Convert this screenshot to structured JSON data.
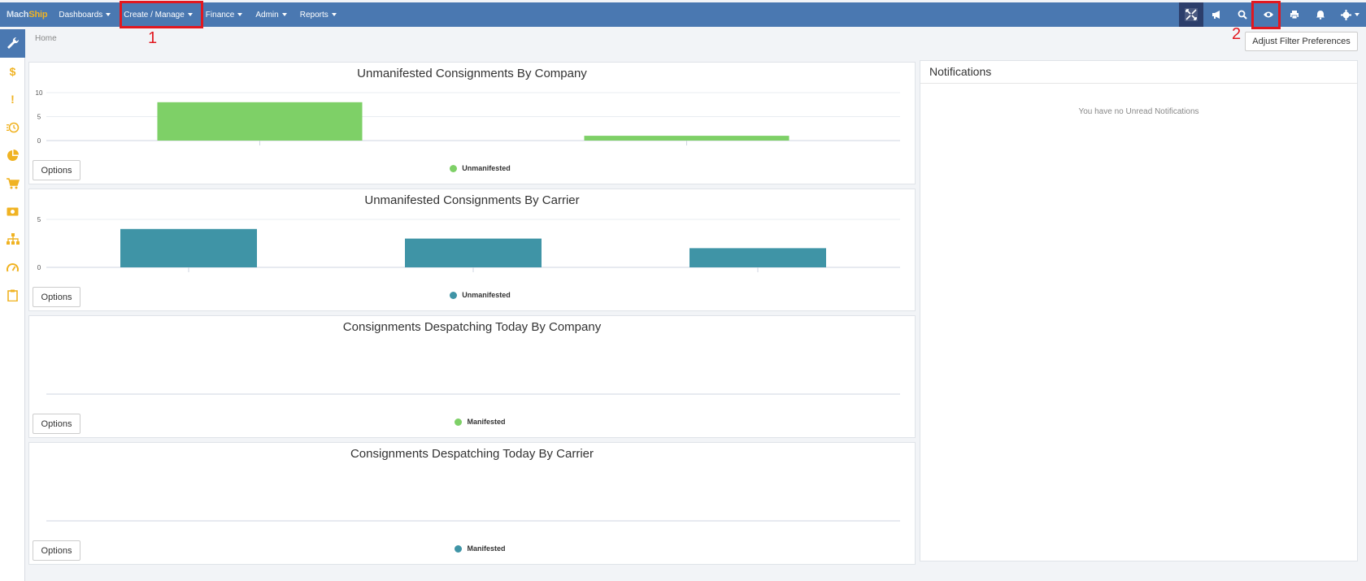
{
  "nav": {
    "logo_prefix": "Mach",
    "logo_suffix": "Ship",
    "items": [
      {
        "label": "Dashboards"
      },
      {
        "label": "Create / Manage"
      },
      {
        "label": "Finance"
      },
      {
        "label": "Admin"
      },
      {
        "label": "Reports"
      }
    ],
    "right_icons": [
      "collapse-icon",
      "megaphone-icon",
      "search-icon",
      "eye-icon",
      "print-icon",
      "bell-icon",
      "settings-icon"
    ]
  },
  "annotations": {
    "label1": "1",
    "label2": "2"
  },
  "sidebar": {
    "items": [
      "wrench-icon",
      "dollar-icon",
      "exclamation-icon",
      "history-icon",
      "pie-chart-icon",
      "cart-icon",
      "money-icon",
      "sitemap-icon",
      "dashboard-icon",
      "clipboard-icon"
    ]
  },
  "breadcrumb": {
    "home": "Home"
  },
  "header": {
    "filter_button": "Adjust Filter Preferences"
  },
  "panels": [
    {
      "title": "Unmanifested Consignments By Company",
      "options": "Options",
      "legend": "Unmanifested",
      "color": "#7ed067"
    },
    {
      "title": "Unmanifested Consignments By Carrier",
      "options": "Options",
      "legend": "Unmanifested",
      "color": "#3f94a6"
    },
    {
      "title": "Consignments Despatching Today By Company",
      "options": "Options",
      "legend": "Manifested",
      "color": "#7ed067"
    },
    {
      "title": "Consignments Despatching Today By Carrier",
      "options": "Options",
      "legend": "Manifested",
      "color": "#3f94a6"
    }
  ],
  "notifications": {
    "title": "Notifications",
    "empty": "You have no Unread Notifications"
  },
  "chart_data": [
    {
      "type": "bar",
      "title": "Unmanifested Consignments By Company",
      "categories": [
        "",
        ""
      ],
      "series": [
        {
          "name": "Unmanifested",
          "values": [
            8,
            1
          ]
        }
      ],
      "ylim": [
        0,
        10
      ],
      "yticks": [
        "0",
        "5",
        "10"
      ],
      "color": "#7ed067"
    },
    {
      "type": "bar",
      "title": "Unmanifested Consignments By Carrier",
      "categories": [
        "",
        "",
        ""
      ],
      "series": [
        {
          "name": "Unmanifested",
          "values": [
            4,
            3,
            2
          ]
        }
      ],
      "ylim": [
        0,
        5
      ],
      "yticks": [
        "0",
        "5"
      ],
      "color": "#3f94a6"
    },
    {
      "type": "bar",
      "title": "Consignments Despatching Today By Company",
      "categories": [],
      "series": [
        {
          "name": "Manifested",
          "values": []
        }
      ],
      "color": "#7ed067"
    },
    {
      "type": "bar",
      "title": "Consignments Despatching Today By Carrier",
      "categories": [],
      "series": [
        {
          "name": "Manifested",
          "values": []
        }
      ],
      "color": "#3f94a6"
    }
  ]
}
